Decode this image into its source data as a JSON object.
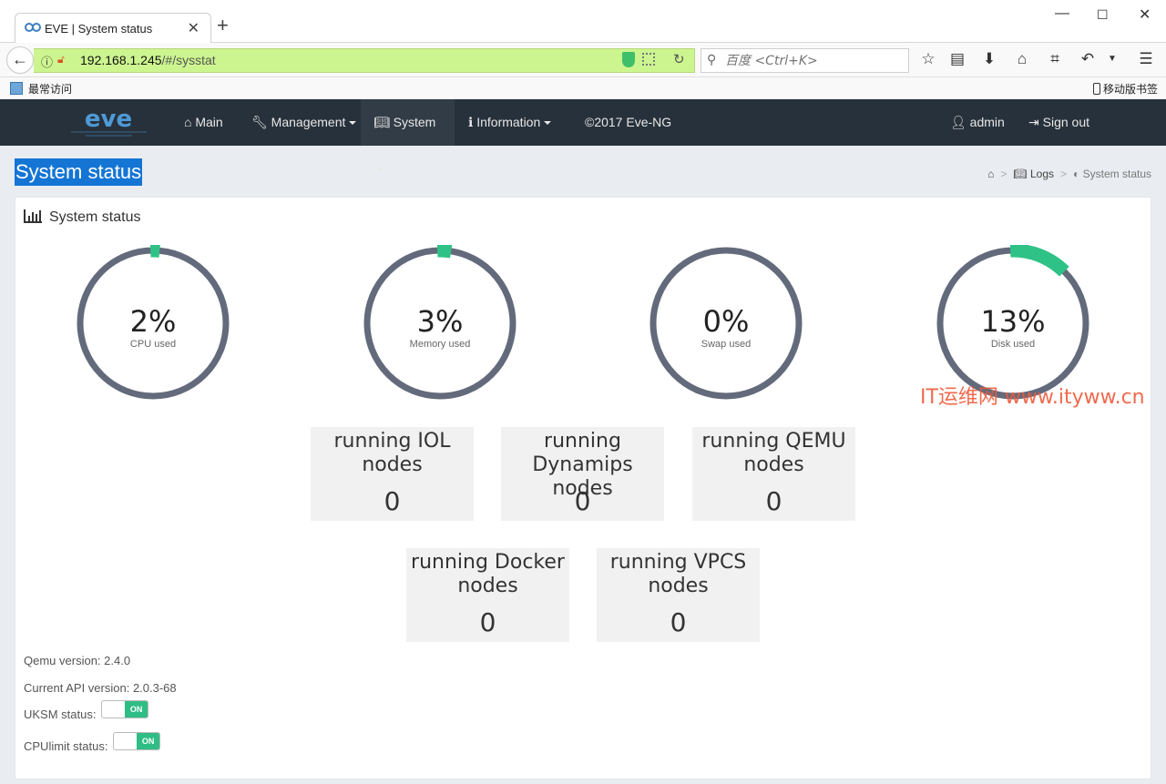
{
  "browser": {
    "tab_title": "EVE | System status",
    "url_host": "192.168.1.245",
    "url_path": "/#/sysstat",
    "search_placeholder": "百度 <Ctrl+K>",
    "bookmark_label": "最常访问",
    "mobile_bookmarks_label": "移动版书签"
  },
  "nav": {
    "logo_text": "eve",
    "items": [
      {
        "label": "Main",
        "icon": "home-icon"
      },
      {
        "label": "Management",
        "icon": "wrench-icon"
      },
      {
        "label": "System",
        "icon": "book-icon"
      },
      {
        "label": "Information",
        "icon": "info-circle-icon"
      },
      {
        "label": "©2017 Eve-NG"
      }
    ],
    "user": "admin",
    "signout": "Sign out"
  },
  "page": {
    "title": "System status",
    "breadcrumb": {
      "logs": "Logs",
      "current": "System status"
    }
  },
  "panel": {
    "title": "System status",
    "gauges": [
      {
        "pct_text": "2%",
        "value": 2,
        "label": "CPU used"
      },
      {
        "pct_text": "3%",
        "value": 3,
        "label": "Memory used"
      },
      {
        "pct_text": "0%",
        "value": 0,
        "label": "Swap used"
      },
      {
        "pct_text": "13%",
        "value": 13,
        "label": "Disk used"
      }
    ],
    "nodes": [
      {
        "title_line1": "running IOL",
        "title_line2": "nodes",
        "count": "0"
      },
      {
        "title_line1": "running",
        "title_line2": "Dynamips nodes",
        "count": "0"
      },
      {
        "title_line1": "running QEMU",
        "title_line2": "nodes",
        "count": "0"
      },
      {
        "title_line1": "running Docker",
        "title_line2": "nodes",
        "count": "0"
      },
      {
        "title_line1": "running VPCS",
        "title_line2": "nodes",
        "count": "0"
      }
    ],
    "qemu_version": "Qemu version: 2.4.0",
    "api_version": "Current API version: 2.0.3-68",
    "uksm_label": "UKSM status:",
    "uksm_state": "ON",
    "cpulimit_label": "CPUlimit status:",
    "cpulimit_state": "ON"
  },
  "colors": {
    "gauge_track": "#636a7b",
    "gauge_fill": "#2fc286",
    "navbar": "#27313b",
    "highlight": "#1475d4"
  },
  "watermark": "IT运维网 www.ityww.cn"
}
